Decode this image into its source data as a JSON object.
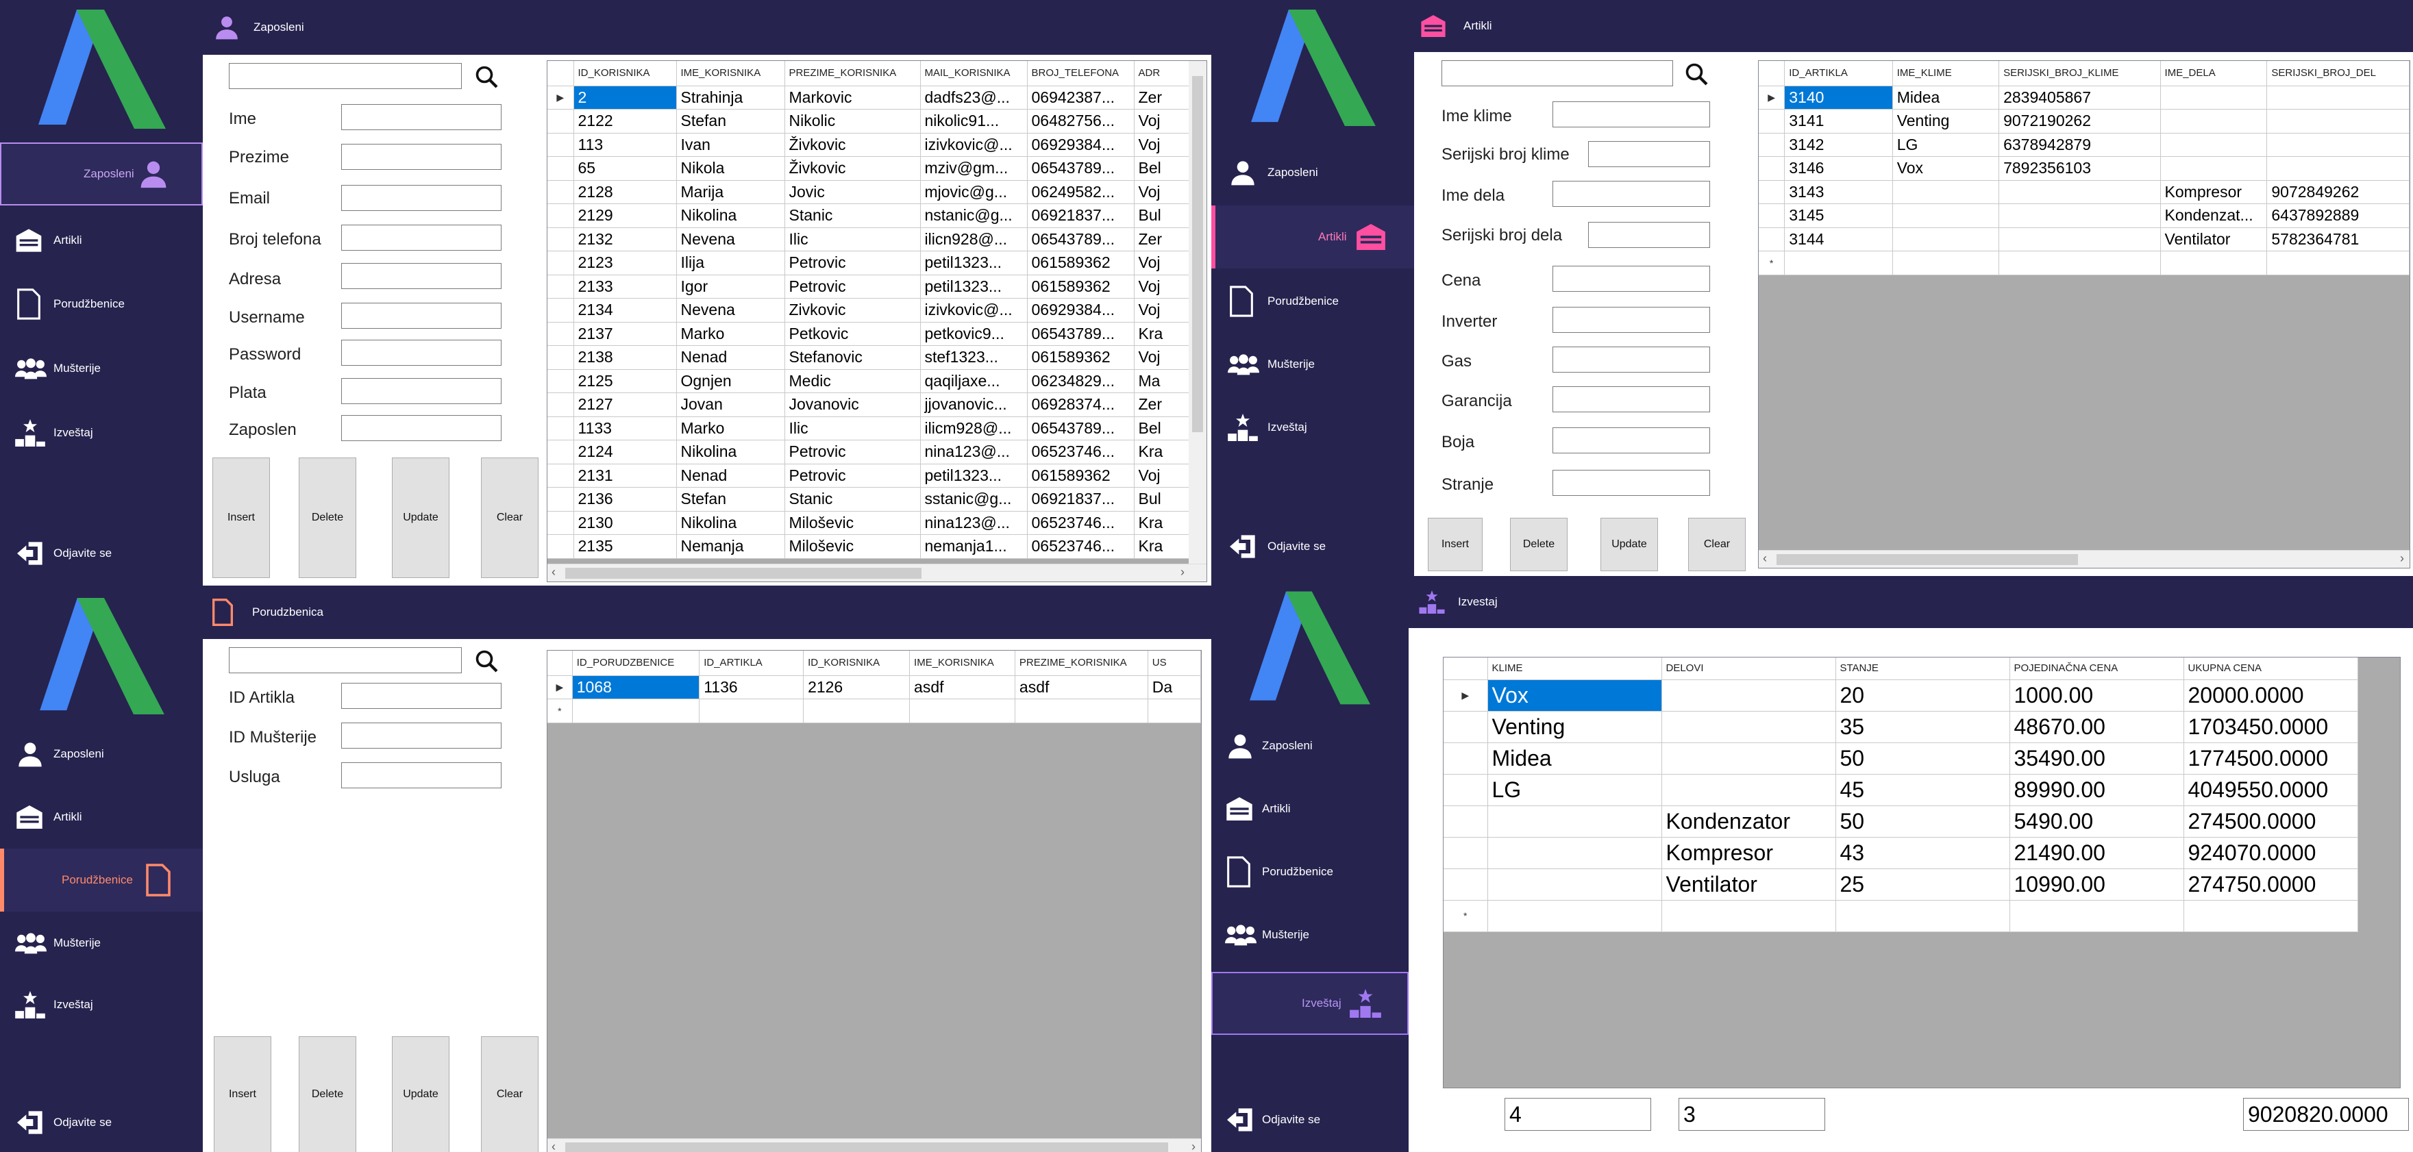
{
  "nav_labels": {
    "zaposleni": "Zaposleni",
    "artikli": "Artikli",
    "porudzbenice": "Porudžbenice",
    "musterije": "Mušterije",
    "izvestaj": "Izveštaj",
    "odjava": "Odjavite se"
  },
  "colors": {
    "sidebar": "#26234f",
    "active_zaposleni": "#b98cf0",
    "active_artikli": "#ff4fa0",
    "active_porudzbenice": "#ff8a6a",
    "active_izvestaj": "#a078f0",
    "selection": "#0078d7"
  },
  "buttons": {
    "insert": "Insert",
    "delete": "Delete",
    "update": "Update",
    "clear": "Clear"
  },
  "zaposleni": {
    "title": "Zaposleni",
    "search_value": "",
    "labels": [
      "Ime",
      "Prezime",
      "Email",
      "Broj telefona",
      "Adresa",
      "Username",
      "Password",
      "Plata",
      "Zaposlen"
    ],
    "grid": {
      "columns": [
        "ID_KORISNIKA",
        "IME_KORISNIKA",
        "PREZIME_KORISNIKA",
        "MAIL_KORISNIKA",
        "BROJ_TELEFONA",
        "ADR"
      ],
      "rows": [
        [
          "2",
          "Strahinja",
          "Markovic",
          "dadfs23@...",
          "06942387...",
          "Zer"
        ],
        [
          "2122",
          "Stefan",
          "Nikolic",
          "nikolic91...",
          "06482756...",
          "Voj"
        ],
        [
          "113",
          "Ivan",
          "Živkovic",
          "izivkovic@...",
          "06929384...",
          "Voj"
        ],
        [
          "65",
          "Nikola",
          "Živkovic",
          "mziv@gm...",
          "06543789...",
          "Bel"
        ],
        [
          "2128",
          "Marija",
          "Jovic",
          "mjovic@g...",
          "06249582...",
          "Voj"
        ],
        [
          "2129",
          "Nikolina",
          "Stanic",
          "nstanic@g...",
          "06921837...",
          "Bul"
        ],
        [
          "2132",
          "Nevena",
          "Ilic",
          "ilicn928@...",
          "06543789...",
          "Zer"
        ],
        [
          "2123",
          "Ilija",
          "Petrovic",
          "petil1323...",
          "061589362",
          "Voj"
        ],
        [
          "2133",
          "Igor",
          "Petrovic",
          "petil1323...",
          "061589362",
          "Voj"
        ],
        [
          "2134",
          "Nevena",
          "Zivkovic",
          "izivkovic@...",
          "06929384...",
          "Voj"
        ],
        [
          "2137",
          "Marko",
          "Petkovic",
          "petkovic9...",
          "06543789...",
          "Kra"
        ],
        [
          "2138",
          "Nenad",
          "Stefanovic",
          "stef1323...",
          "061589362",
          "Voj"
        ],
        [
          "2125",
          "Ognjen",
          "Medic",
          "qaqiljaxe...",
          "06234829...",
          "Ma"
        ],
        [
          "2127",
          "Jovan",
          "Jovanovic",
          "jjovanovic...",
          "06928374...",
          "Zer"
        ],
        [
          "1133",
          "Marko",
          "Ilic",
          "ilicm928@...",
          "06543789...",
          "Bel"
        ],
        [
          "2124",
          "Nikolina",
          "Petrovic",
          "nina123@...",
          "06523746...",
          "Kra"
        ],
        [
          "2131",
          "Nenad",
          "Petrovic",
          "petil1323...",
          "061589362",
          "Voj"
        ],
        [
          "2136",
          "Stefan",
          "Stanic",
          "sstanic@g...",
          "06921837...",
          "Bul"
        ],
        [
          "2130",
          "Nikolina",
          "Miloševic",
          "nina123@...",
          "06523746...",
          "Kra"
        ],
        [
          "2135",
          "Nemanja",
          "Miloševic",
          "nemanja1...",
          "06523746...",
          "Kra"
        ]
      ]
    }
  },
  "artikli": {
    "title": "Artikli",
    "search_value": "",
    "labels": [
      "Ime klime",
      "Serijski broj klime",
      "Ime dela",
      "Serijski broj dela",
      "Cena",
      "Inverter",
      "Gas",
      "Garancija",
      "Boja",
      "Stranje"
    ],
    "grid": {
      "columns": [
        "ID_ARTIKLA",
        "IME_KLIME",
        "SERIJSKI_BROJ_KLIME",
        "IME_DELA",
        "SERIJSKI_BROJ_DEL"
      ],
      "rows": [
        [
          "3140",
          "Midea",
          "2839405867",
          "",
          ""
        ],
        [
          "3141",
          "Venting",
          "9072190262",
          "",
          ""
        ],
        [
          "3142",
          "LG",
          "6378942879",
          "",
          ""
        ],
        [
          "3146",
          "Vox",
          "7892356103",
          "",
          ""
        ],
        [
          "3143",
          "",
          "",
          "Kompresor",
          "9072849262"
        ],
        [
          "3145",
          "",
          "",
          "Kondenzat...",
          "6437892889"
        ],
        [
          "3144",
          "",
          "",
          "Ventilator",
          "5782364781"
        ]
      ]
    }
  },
  "porudzbenice": {
    "title": "Porudzbenica",
    "search_value": "",
    "labels": [
      "ID Artikla",
      "ID Mušterije",
      "Usluga"
    ],
    "grid": {
      "columns": [
        "ID_PORUDZBENICE",
        "ID_ARTIKLA",
        "ID_KORISNIKA",
        "IME_KORISNIKA",
        "PREZIME_KORISNIKA",
        "US"
      ],
      "rows": [
        [
          "1068",
          "1136",
          "2126",
          "asdf",
          "asdf",
          "Da"
        ]
      ]
    }
  },
  "izvestaj": {
    "title": "Izvestaj",
    "grid": {
      "columns": [
        "KLIME",
        "DELOVI",
        "STANJE",
        "POJEDINAČNA CENA",
        "UKUPNA CENA"
      ],
      "rows": [
        [
          "Vox",
          "",
          "20",
          "1000.00",
          "20000.0000"
        ],
        [
          "Venting",
          "",
          "35",
          "48670.00",
          "1703450.0000"
        ],
        [
          "Midea",
          "",
          "50",
          "35490.00",
          "1774500.0000"
        ],
        [
          "LG",
          "",
          "45",
          "89990.00",
          "4049550.0000"
        ],
        [
          "",
          "Kondenzator",
          "50",
          "5490.00",
          "274500.0000"
        ],
        [
          "",
          "Kompresor",
          "43",
          "21490.00",
          "924070.0000"
        ],
        [
          "",
          "Ventilator",
          "25",
          "10990.00",
          "274750.0000"
        ]
      ]
    },
    "footer": {
      "count_klime": "4",
      "count_delovi": "3",
      "total": "9020820.0000"
    }
  }
}
